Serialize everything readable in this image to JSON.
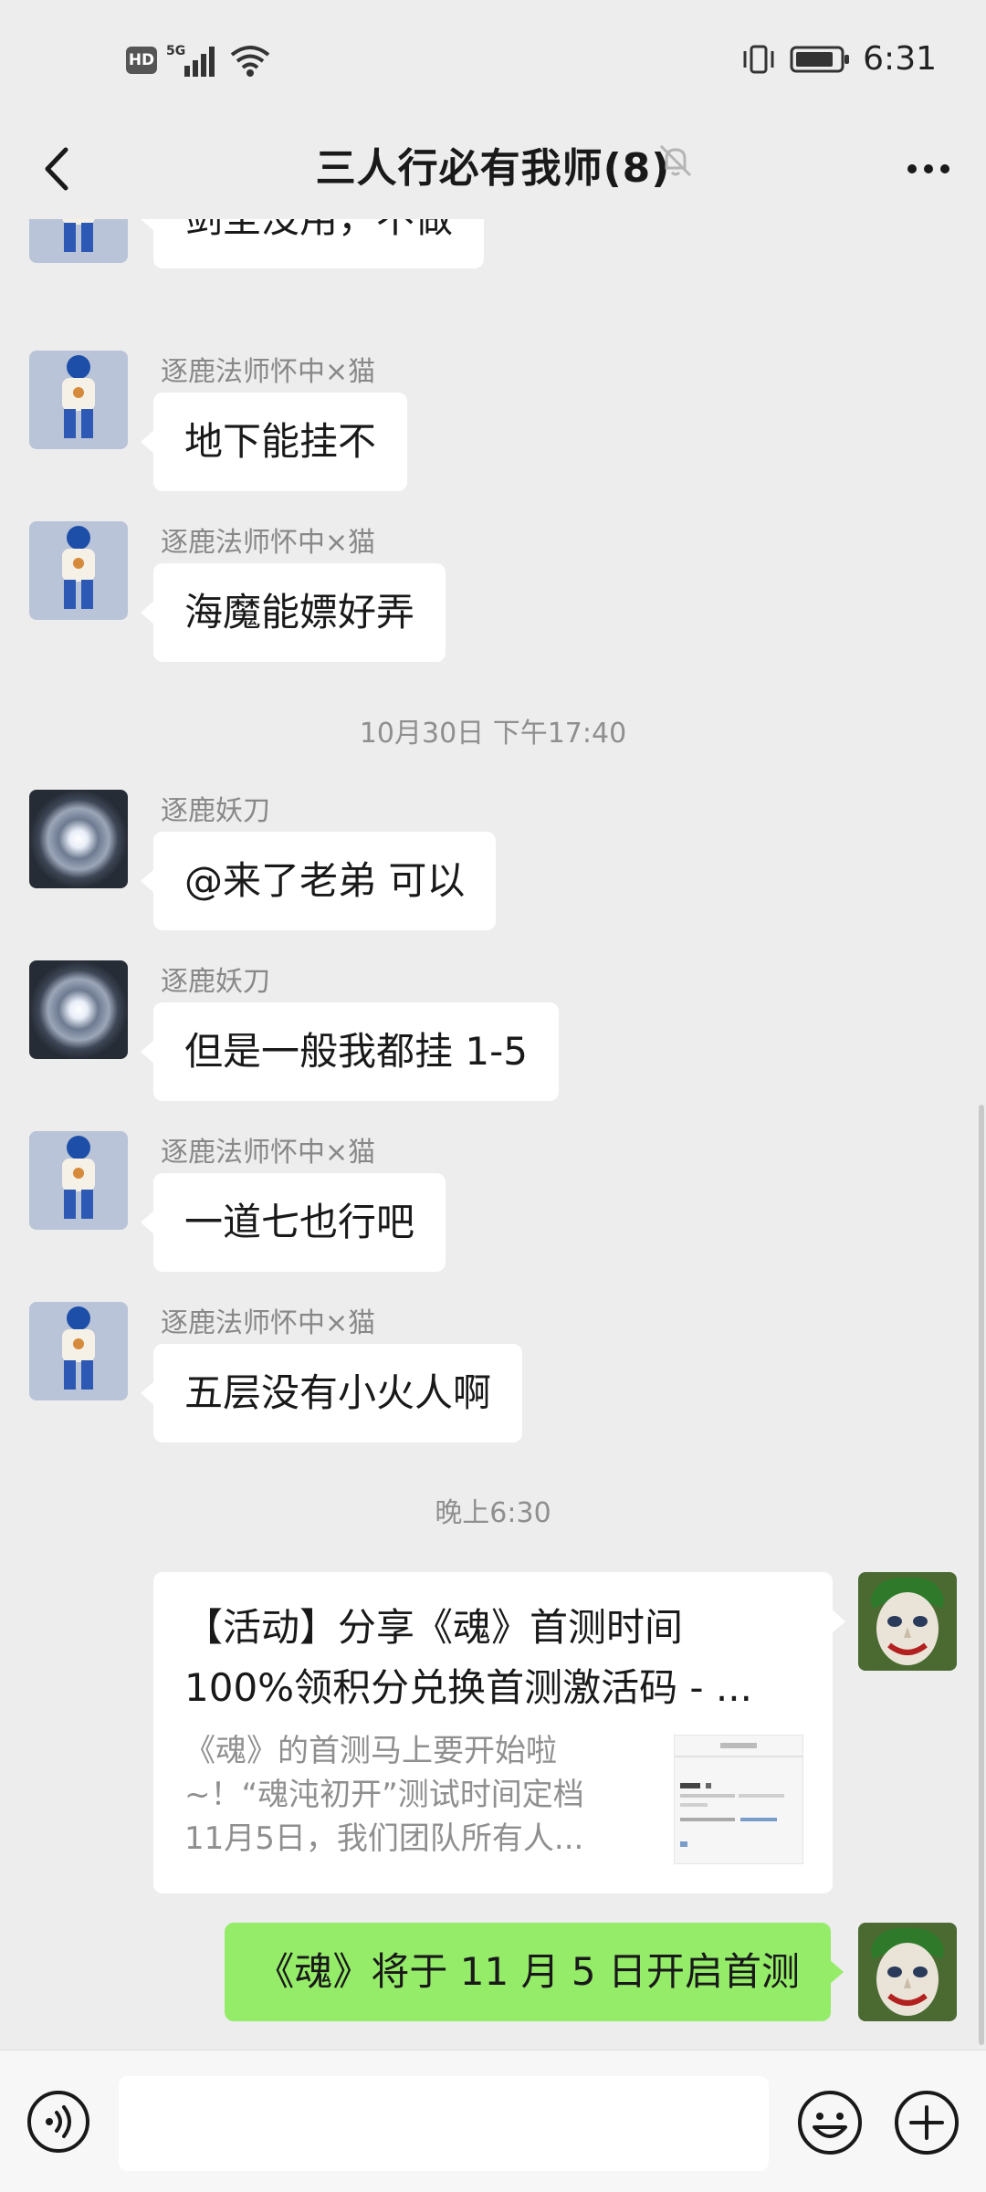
{
  "status_bar": {
    "hd": "HD",
    "network": "5G",
    "time": "6:31"
  },
  "header": {
    "title": "三人行必有我师(8)"
  },
  "messages": [
    {
      "sender": "",
      "text": "剑圣没用，不做"
    },
    {
      "sender": "逐鹿法师怀中×猫",
      "text": "地下能挂不"
    },
    {
      "sender": "逐鹿法师怀中×猫",
      "text": "海魔能嫖好弄"
    },
    {
      "time": "10月30日 下午17:40"
    },
    {
      "sender": "逐鹿妖刀",
      "text": "@来了老弟  可以"
    },
    {
      "sender": "逐鹿妖刀",
      "text": "但是一般我都挂 1-5"
    },
    {
      "sender": "逐鹿法师怀中×猫",
      "text": "一道七也行吧"
    },
    {
      "sender": "逐鹿法师怀中×猫",
      "text": "五层没有小火人啊"
    },
    {
      "time": "晚上6:30"
    }
  ],
  "link_card": {
    "title_line1": "【活动】分享《魂》首测时间",
    "title_line2": "100%领积分兑换首测激活码 - ...",
    "desc_line1": "《魂》的首测马上要开始啦",
    "desc_line2": "~！“魂沌初开”测试时间定档",
    "desc_line3": "11月5日，我们团队所有人..."
  },
  "my_message": {
    "text": "《魂》将于 11 月 5 日开启首测"
  },
  "input": {
    "placeholder": ""
  }
}
